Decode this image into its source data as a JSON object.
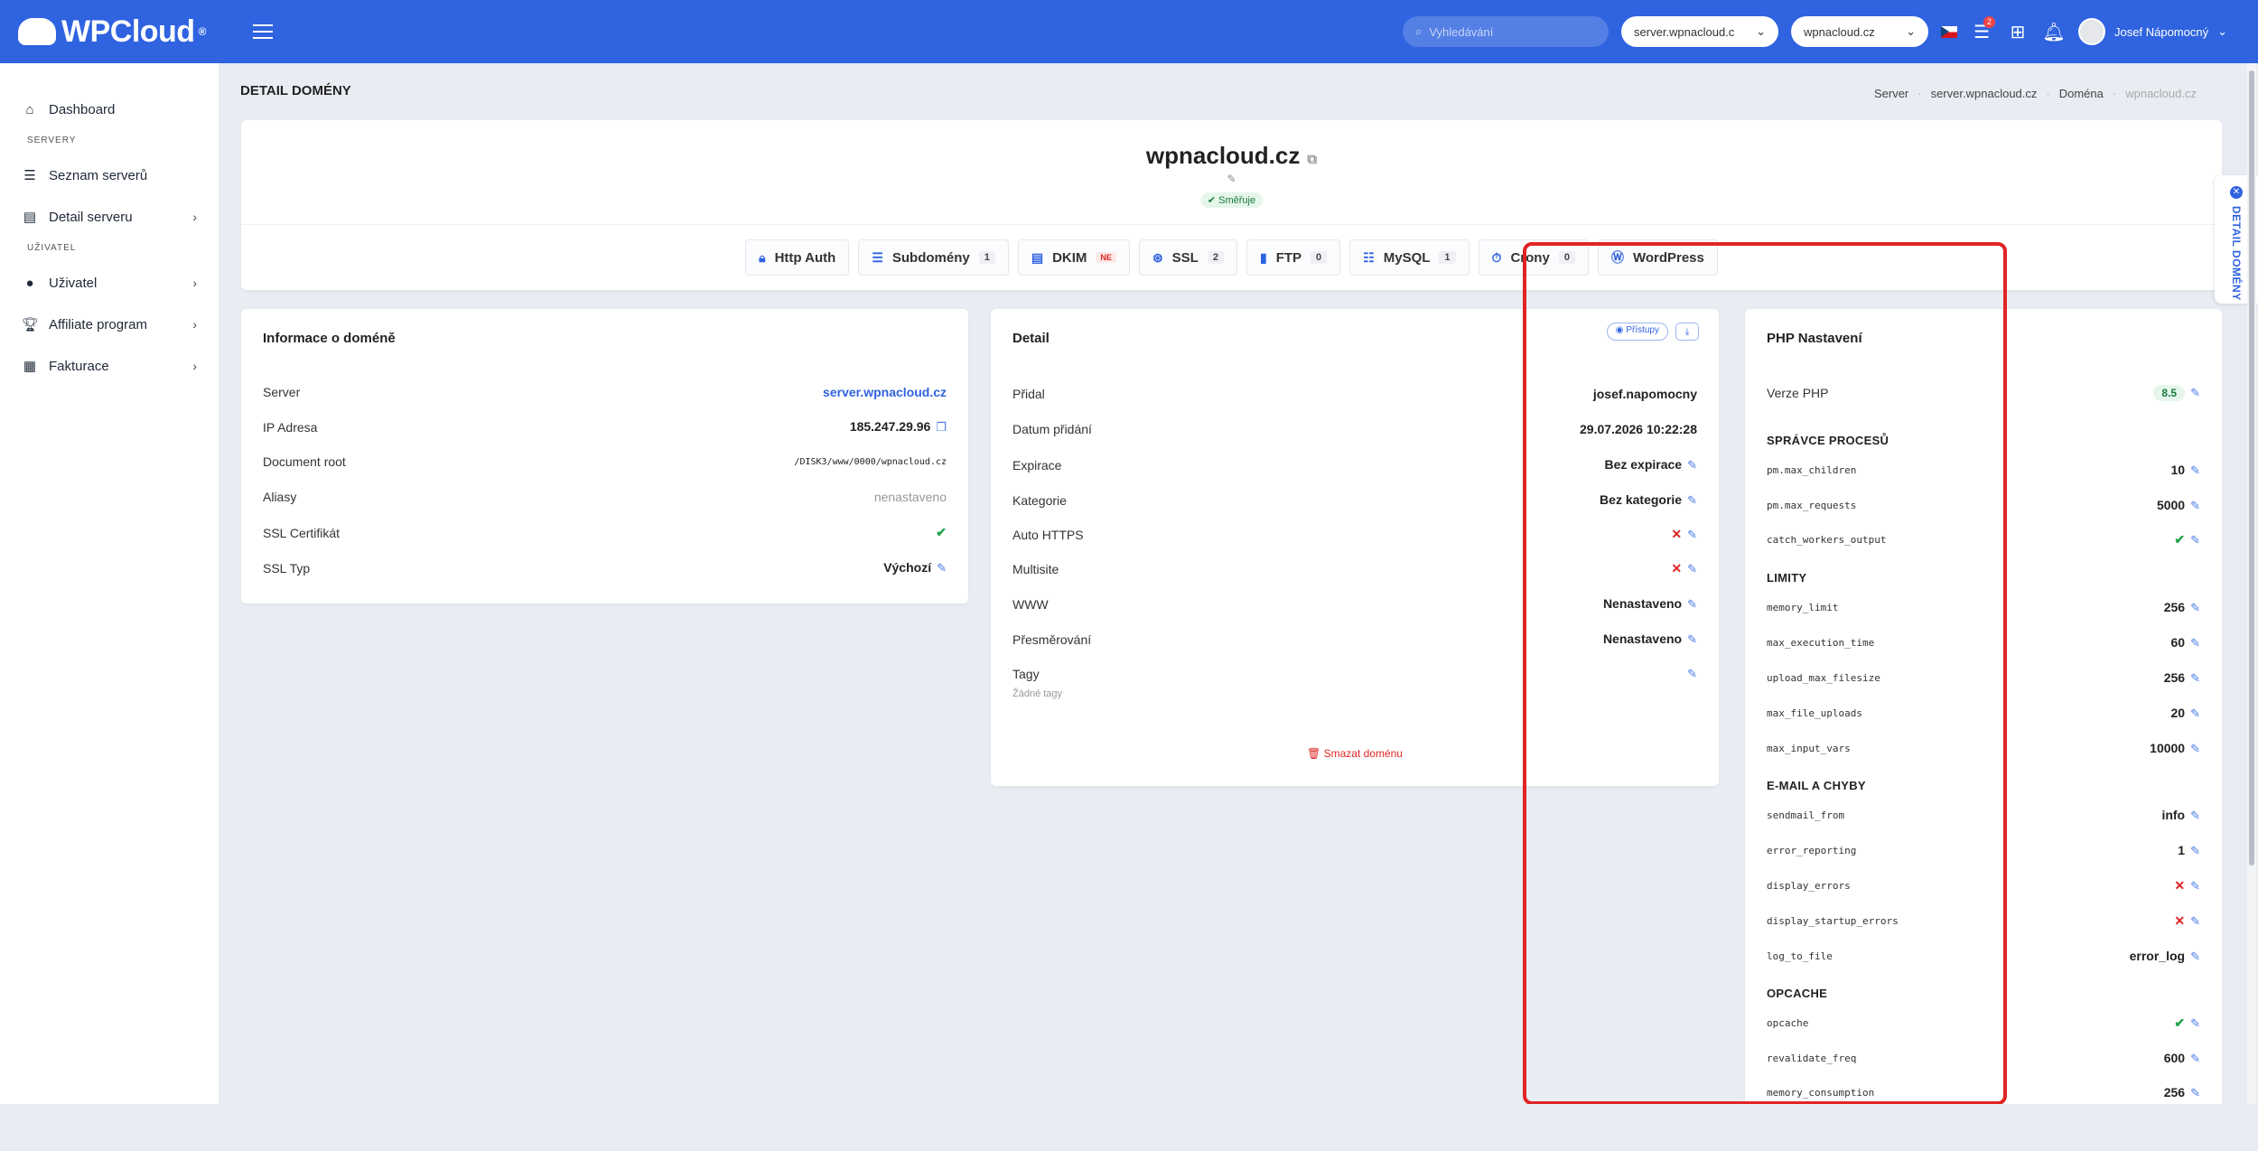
{
  "topbar": {
    "logo": "WPCloud",
    "logo_mark": "®",
    "search_placeholder": "Vyhledávání",
    "server_select": "server.wpnacloud.c",
    "domain_select": "wpnacloud.cz",
    "notif_count": "2",
    "user_name": "Josef Nápomocný"
  },
  "sidebar": {
    "items": [
      {
        "label": "Dashboard",
        "icon": "home-icon"
      },
      {
        "section": "SERVERY"
      },
      {
        "label": "Seznam serverů",
        "icon": "list-icon"
      },
      {
        "label": "Detail serveru",
        "icon": "server-icon"
      },
      {
        "section": "UŽIVATEL"
      },
      {
        "label": "Uživatel",
        "icon": "user-icon"
      },
      {
        "label": "Affiliate program",
        "icon": "trophy-icon"
      },
      {
        "label": "Fakturace",
        "icon": "invoice-icon"
      }
    ]
  },
  "page": {
    "title": "DETAIL DOMÉNY",
    "breadcrumb": [
      "Server",
      "server.wpnacloud.cz",
      "Doména",
      "wpnacloud.cz"
    ]
  },
  "domain": {
    "name": "wpnacloud.cz",
    "status": "Směřuje",
    "tabs": [
      {
        "label": "Http Auth",
        "count": ""
      },
      {
        "label": "Subdomény",
        "count": "1"
      },
      {
        "label": "DKIM",
        "count": "NE"
      },
      {
        "label": "SSL",
        "count": "2"
      },
      {
        "label": "FTP",
        "count": "0"
      },
      {
        "label": "MySQL",
        "count": "1"
      },
      {
        "label": "Crony",
        "count": "0"
      },
      {
        "label": "WordPress",
        "count": ""
      }
    ]
  },
  "info": {
    "title": "Informace o doméně",
    "rows": [
      {
        "k": "Server",
        "v": "server.wpnacloud.cz"
      },
      {
        "k": "IP Adresa",
        "v": "185.247.29.96"
      },
      {
        "k": "Document root",
        "v": "/DISK3/www/0000/wpnacloud.cz"
      },
      {
        "k": "Aliasy",
        "v": "nenastaveno"
      },
      {
        "k": "SSL Certifikát",
        "v": "✔"
      },
      {
        "k": "SSL Typ",
        "v": "Výchozí"
      }
    ]
  },
  "detail": {
    "title": "Detail",
    "access_btn": "Přístupy",
    "rows": [
      {
        "k": "Přidal",
        "v": "josef.napomocny"
      },
      {
        "k": "Datum přidání",
        "v": "29.07.2026 10:22:28"
      },
      {
        "k": "Expirace",
        "v": "Bez expirace"
      },
      {
        "k": "Kategorie",
        "v": "Bez kategorie"
      },
      {
        "k": "Auto HTTPS",
        "v": "✕"
      },
      {
        "k": "Multisite",
        "v": "✕"
      },
      {
        "k": "WWW",
        "v": "Nenastaveno"
      },
      {
        "k": "Přesměrování",
        "v": "Nenastaveno"
      },
      {
        "k": "Tagy",
        "v": ""
      }
    ],
    "tags_empty": "Žádné tagy",
    "delete": "Smazat doménu"
  },
  "php": {
    "title": "PHP Nastavení",
    "version_label": "Verze PHP",
    "version": "8.5",
    "sections": [
      {
        "name": "SPRÁVCE PROCESŮ",
        "rows": [
          {
            "k": "pm.max_children",
            "v": "10"
          },
          {
            "k": "pm.max_requests",
            "v": "5000"
          },
          {
            "k": "catch_workers_output",
            "v": "✔"
          }
        ]
      },
      {
        "name": "LIMITY",
        "rows": [
          {
            "k": "memory_limit",
            "v": "256"
          },
          {
            "k": "max_execution_time",
            "v": "60"
          },
          {
            "k": "upload_max_filesize",
            "v": "256"
          },
          {
            "k": "max_file_uploads",
            "v": "20"
          },
          {
            "k": "max_input_vars",
            "v": "10000"
          }
        ]
      },
      {
        "name": "E-MAIL A CHYBY",
        "rows": [
          {
            "k": "sendmail_from",
            "v": "info"
          },
          {
            "k": "error_reporting",
            "v": "1"
          },
          {
            "k": "display_errors",
            "v": "✕"
          },
          {
            "k": "display_startup_errors",
            "v": "✕"
          },
          {
            "k": "log_to_file",
            "v": "error_log"
          }
        ]
      },
      {
        "name": "OPCACHE",
        "rows": [
          {
            "k": "opcache",
            "v": "✔"
          },
          {
            "k": "revalidate_freq",
            "v": "600"
          },
          {
            "k": "memory_consumption",
            "v": "256"
          }
        ]
      }
    ]
  },
  "side_tab": "DETAIL DOMÉNY"
}
